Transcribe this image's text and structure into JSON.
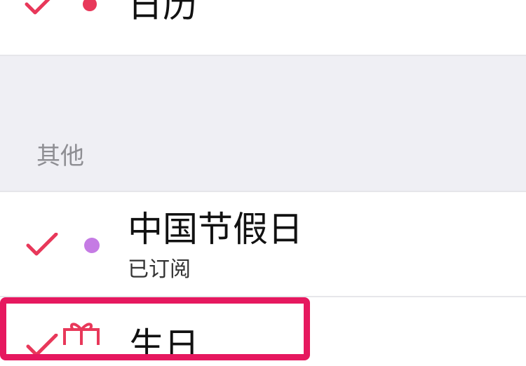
{
  "calendars": {
    "top_item": {
      "label": "日历",
      "checked": true,
      "dot_color": "#e8385a"
    },
    "section_header": "其他",
    "items": [
      {
        "label": "中国节假日",
        "subtitle": "已订阅",
        "checked": true,
        "dot_color": "#c57be4"
      },
      {
        "label": "生日",
        "checked": true,
        "icon": "gift-icon"
      }
    ]
  },
  "colors": {
    "check": "#e8385a",
    "highlight": "#e6185f",
    "section_background": "#efeff4"
  }
}
